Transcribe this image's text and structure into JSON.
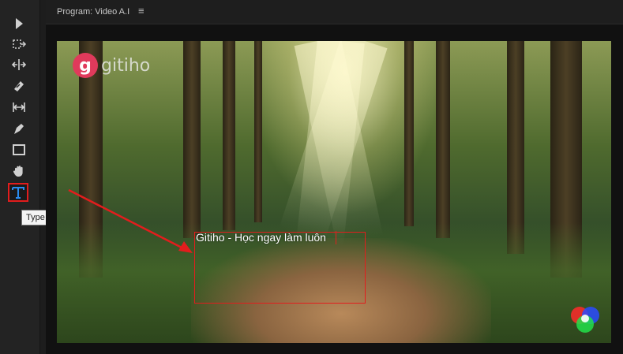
{
  "toolbar": {
    "tools": [
      {
        "name": "selection-tool",
        "icon": "arrow-pointer-icon"
      },
      {
        "name": "track-select-tool",
        "icon": "track-select-forward-icon"
      },
      {
        "name": "ripple-edit-tool",
        "icon": "ripple-edit-icon"
      },
      {
        "name": "razor-tool",
        "icon": "razor-icon"
      },
      {
        "name": "slip-tool",
        "icon": "slip-icon"
      },
      {
        "name": "pen-tool",
        "icon": "pen-icon"
      },
      {
        "name": "rectangle-tool",
        "icon": "rectangle-icon"
      },
      {
        "name": "hand-tool",
        "icon": "hand-icon"
      },
      {
        "name": "type-tool",
        "icon": "type-t-icon",
        "active": true
      }
    ],
    "tooltip": "Type Tool (T)"
  },
  "panel": {
    "title": "Program: Video A.I",
    "menu_glyph": "≡"
  },
  "video": {
    "logo_mark": "g",
    "logo_text": "gitiho",
    "overlay_text": "Gitiho - Học ngay làm luôn"
  },
  "colors": {
    "highlight_red": "#e21d1d",
    "tool_icon": "#d0d0d0",
    "type_tool_blue": "#2a8cf0",
    "logo_pink": "#e03a5b"
  }
}
